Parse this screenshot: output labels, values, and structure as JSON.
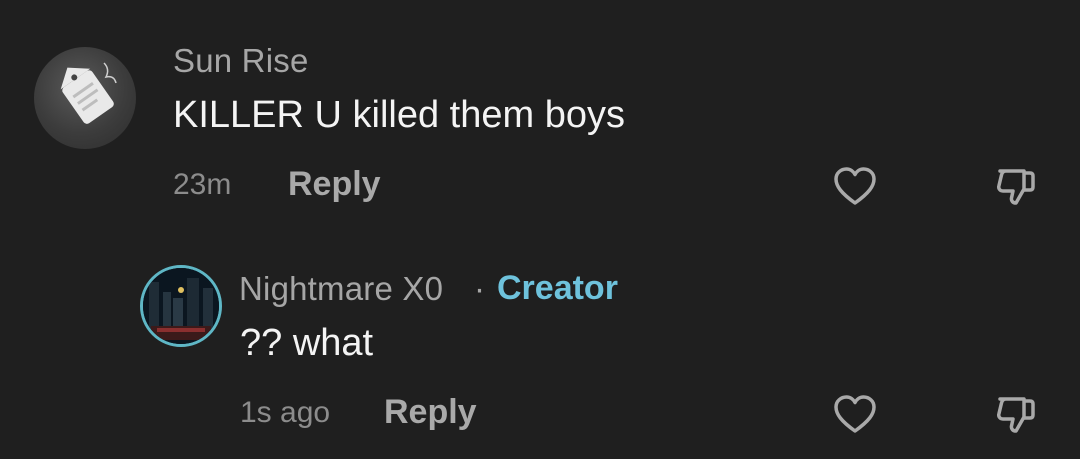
{
  "comments": [
    {
      "username": "Sun Rise",
      "text": "KILLER U killed them boys",
      "time": "23m",
      "reply_label": "Reply"
    }
  ],
  "reply": {
    "username": "Nightmare",
    "username_suffix": "X0",
    "separator": "·",
    "badge": "Creator",
    "text": "?? what",
    "time": "1s ago",
    "reply_label": "Reply"
  },
  "icons": {
    "like": "heart-icon",
    "dislike": "thumbs-down-icon"
  },
  "colors": {
    "background": "#1f1f1f",
    "creator_badge": "#6ec2dc",
    "avatar_ring": "#5fb7c6"
  }
}
